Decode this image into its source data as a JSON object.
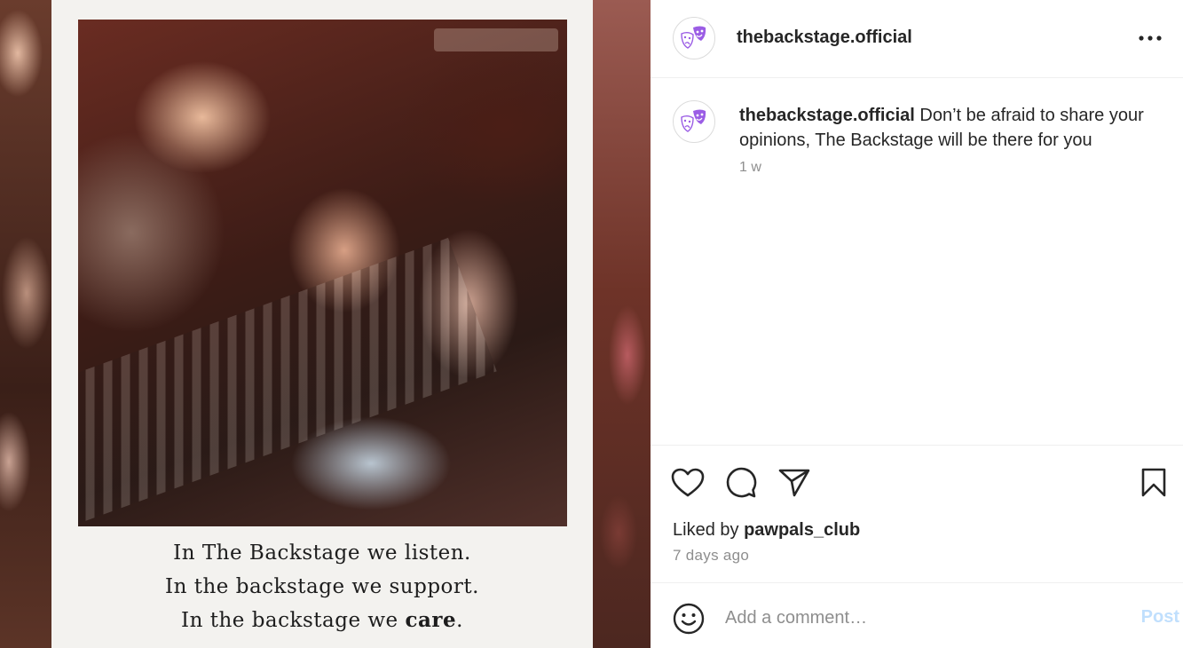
{
  "post": {
    "media": {
      "caption_lines": [
        "In The Backstage we listen.",
        "In the backstage we support.",
        "In the backstage we"
      ],
      "caption_emphasis": "care",
      "caption_end": "."
    },
    "header": {
      "username": "thebackstage.official",
      "more_icon": "more-horizontal-icon"
    },
    "caption": {
      "username": "thebackstage.official",
      "text": " Don’t be afraid to share your opinions, The Backstage will be there for you",
      "time": "1 w"
    },
    "actions": {
      "icons": [
        "heart-icon",
        "comment-icon",
        "share-icon",
        "bookmark-icon"
      ],
      "liked_by_prefix": "Liked by ",
      "liked_by_user": "pawpals_club",
      "time_ago": "7 days ago"
    },
    "comment": {
      "placeholder": "Add a comment…",
      "post_label": "Post",
      "emoji_icon": "emoji-icon"
    },
    "colors": {
      "avatar_accent": "#9b5de5",
      "post_disabled": "#c0dffd",
      "muted_text": "#8e8e8e"
    }
  }
}
